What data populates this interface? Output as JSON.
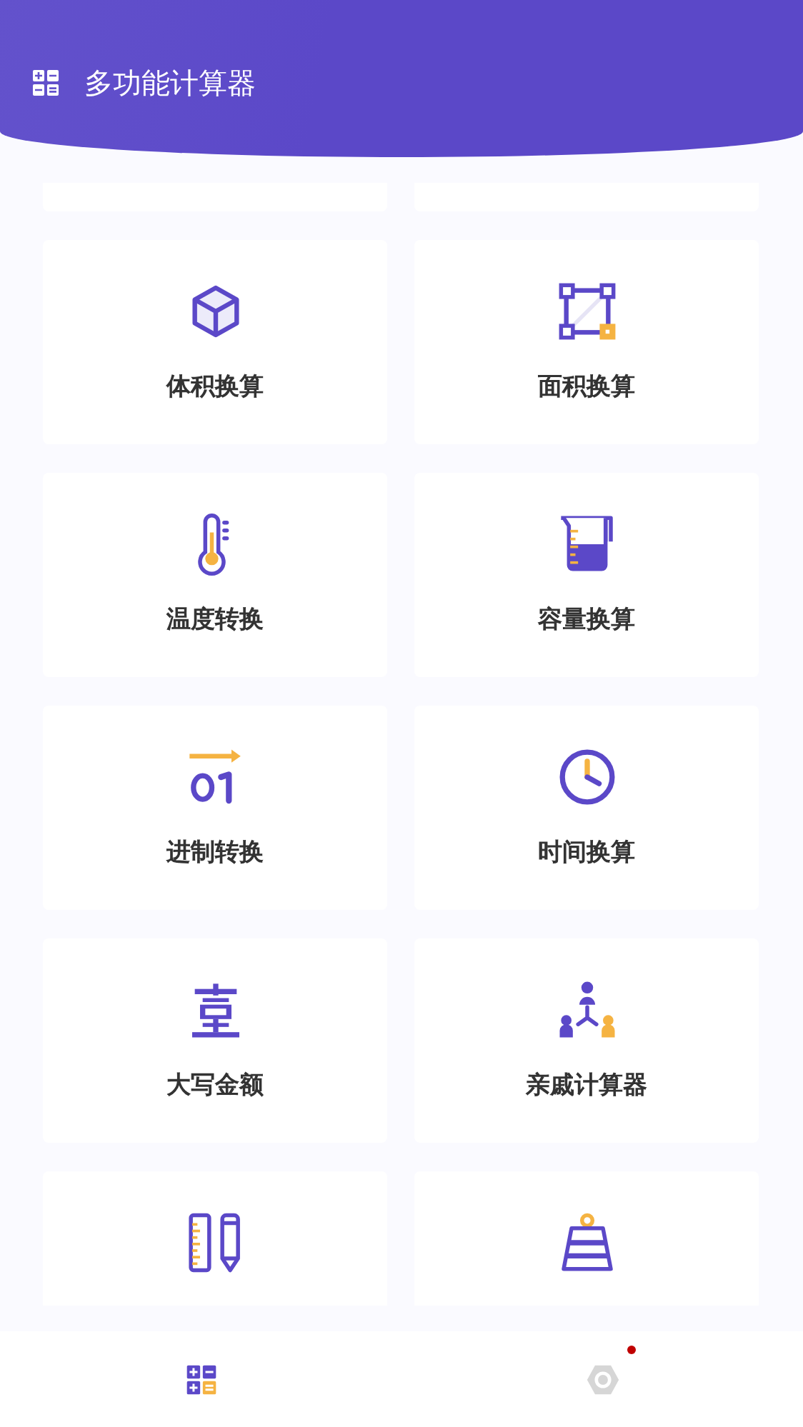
{
  "header": {
    "title": "多功能计算器"
  },
  "tools": [
    {
      "kind": "cube",
      "label": "体积换算"
    },
    {
      "kind": "area",
      "label": "面积换算"
    },
    {
      "kind": "thermometer",
      "label": "温度转换"
    },
    {
      "kind": "beaker",
      "label": "容量换算"
    },
    {
      "kind": "binary",
      "label": "进制转换"
    },
    {
      "kind": "clock",
      "label": "时间换算"
    },
    {
      "kind": "numeral",
      "label": "大写金额"
    },
    {
      "kind": "relatives",
      "label": "亲戚计算器"
    },
    {
      "kind": "ruler"
    },
    {
      "kind": "weight"
    }
  ],
  "nav": [
    {
      "kind": "calculator",
      "selected": true,
      "badge": false
    },
    {
      "kind": "settings",
      "selected": false,
      "badge": true
    }
  ]
}
